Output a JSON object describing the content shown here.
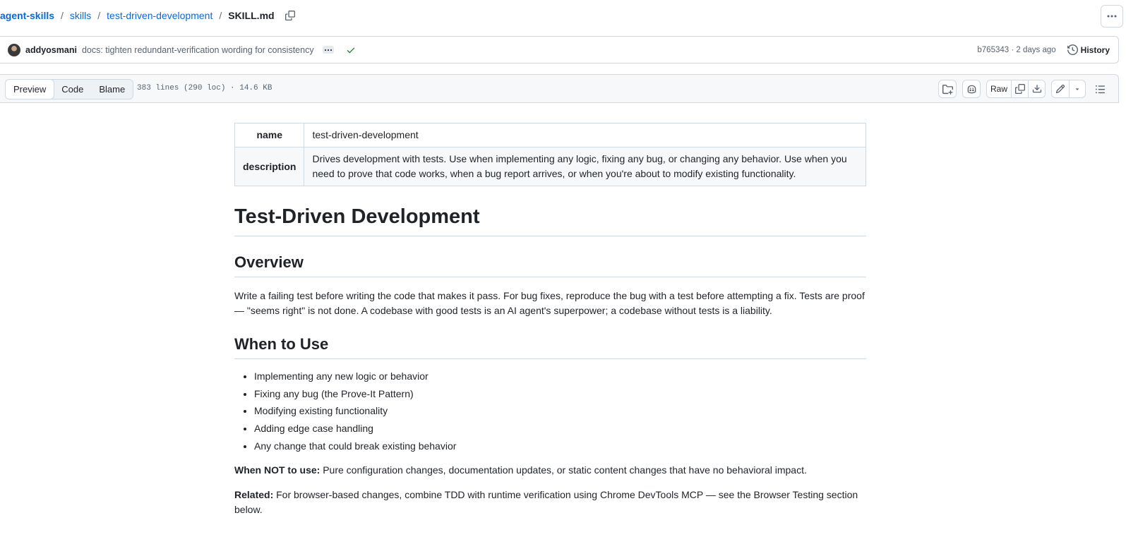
{
  "breadcrumb": {
    "repo": "agent-skills",
    "sep": "/",
    "folder": "skills",
    "subfolder": "test-driven-development",
    "file": "SKILL.md"
  },
  "commit": {
    "author": "addyosmani",
    "message": "docs: tighten redundant-verification wording for consistency",
    "sha_time": "b765343 · 2 days ago",
    "history_label": "History"
  },
  "file_header": {
    "tabs": [
      "Preview",
      "Code",
      "Blame"
    ],
    "active_tab": "Preview",
    "info": "383 lines (290 loc) · 14.6 KB",
    "raw_label": "Raw"
  },
  "frontmatter": {
    "rows": [
      {
        "key": "name",
        "value": "test-driven-development"
      },
      {
        "key": "description",
        "value": "Drives development with tests. Use when implementing any logic, fixing any bug, or changing any behavior. Use when you need to prove that code works, when a bug report arrives, or when you're about to modify existing functionality."
      }
    ]
  },
  "doc": {
    "title": "Test-Driven Development",
    "overview_heading": "Overview",
    "overview_text": "Write a failing test before writing the code that makes it pass. For bug fixes, reproduce the bug with a test before attempting a fix. Tests are proof — \"seems right\" is not done. A codebase with good tests is an AI agent's superpower; a codebase without tests is a liability.",
    "when_heading": "When to Use",
    "when_items": [
      "Implementing any new logic or behavior",
      "Fixing any bug (the Prove-It Pattern)",
      "Modifying existing functionality",
      "Adding edge case handling",
      "Any change that could break existing behavior"
    ],
    "not_label": "When NOT to use:",
    "not_text": " Pure configuration changes, documentation updates, or static content changes that have no behavioral impact.",
    "related_label": "Related:",
    "related_text": " For browser-based changes, combine TDD with runtime verification using Chrome DevTools MCP — see the Browser Testing section below."
  },
  "icons": {
    "copy": "copy-icon",
    "more": "kebab-horizontal-icon",
    "check": "check-icon",
    "history": "history-icon",
    "add_file": "file-directory-add-icon",
    "copilot": "copilot-icon",
    "download": "download-icon",
    "edit": "pencil-icon",
    "dropdown": "triangle-down-icon",
    "outline": "list-unordered-icon"
  },
  "colors": {
    "link": "#0969da",
    "success": "#1a7f37",
    "border": "#d1d9e0",
    "muted": "#59636e"
  }
}
